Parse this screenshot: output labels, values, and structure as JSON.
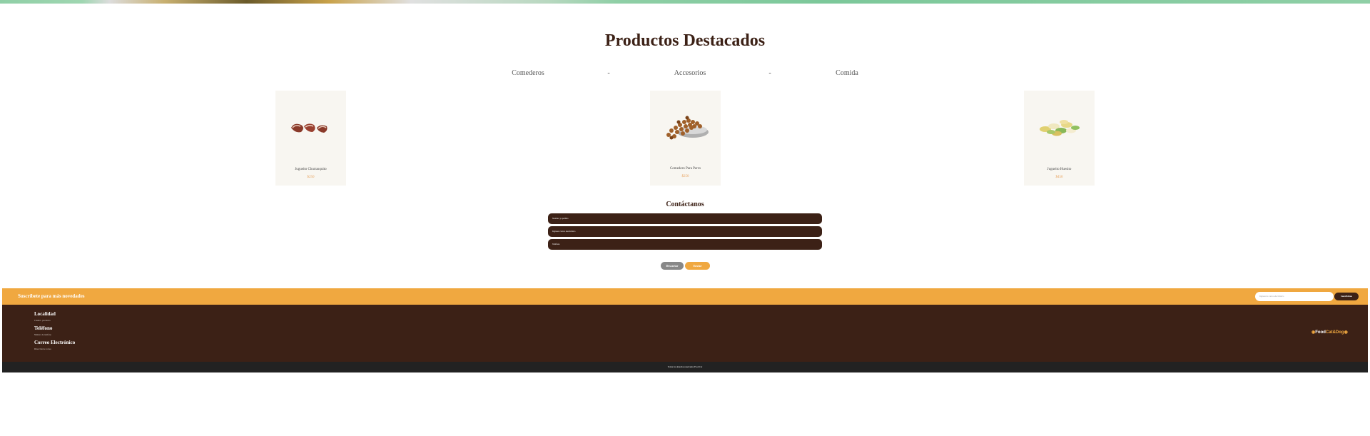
{
  "featured": {
    "title": "Productos Destacados",
    "categories": [
      "Comederos",
      "Accesorios",
      "Comida"
    ],
    "separator": "-",
    "products": [
      {
        "name": "Jugueito Churrasquito",
        "price": "$250",
        "image_icon": "steak-treat-icon"
      },
      {
        "name": "Comedero Para Perro",
        "price": "$250",
        "image_icon": "kibble-bowl-icon"
      },
      {
        "name": "Jugueito Huesito",
        "price": "$450",
        "image_icon": "bone-treats-icon"
      }
    ]
  },
  "contact": {
    "title": "Contáctanos",
    "fields": [
      {
        "placeholder": "Nombre y apellido"
      },
      {
        "placeholder": "Ingresar correo electrónico"
      },
      {
        "placeholder": "Teléfono"
      }
    ],
    "reset_label": "Descartar",
    "submit_label": "Enviar"
  },
  "subscribe": {
    "title": "Suscríbete para más novedades",
    "input_placeholder": "Ingresa tu correo electrónico",
    "button_label": "Suscribirme"
  },
  "footer": {
    "items": [
      {
        "heading": "Localidad",
        "detail": "Ciudad - provincia"
      },
      {
        "heading": "Teléfono",
        "detail": "Número de teléfono"
      },
      {
        "heading": "Correo Electrónico",
        "detail": "Dirección de correo"
      }
    ],
    "brand": {
      "part1": "Food",
      "part2": "Cat&Dog",
      "icon": "paw-icon"
    },
    "copyright": "Todos los derechos reservados Food Cat"
  },
  "colors": {
    "brown": "#3c2116",
    "orange": "#f0a840",
    "grey_button": "#888888",
    "dark": "#222222"
  }
}
